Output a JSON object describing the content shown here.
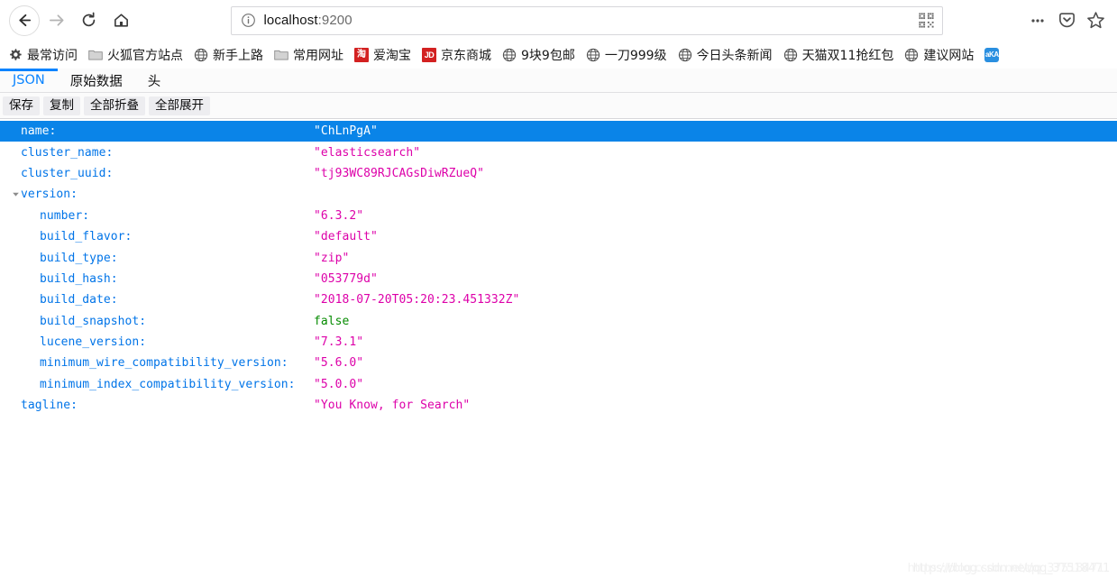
{
  "browser": {
    "nav": {
      "back_label": "Back",
      "forward_label": "Forward",
      "reload_label": "Reload",
      "home_label": "Home"
    },
    "address_bar": {
      "host": "localhost",
      "port": ":9200",
      "full_url": "localhost:9200",
      "info_icon": "info-icon",
      "qr_icon": "qr-code-icon"
    },
    "toolbar_icons": [
      {
        "name": "more-menu-icon",
        "glyph": "•••"
      },
      {
        "name": "pocket-icon"
      },
      {
        "name": "bookmark-star-icon"
      }
    ]
  },
  "bookmarks": {
    "items": [
      {
        "label": "最常访问",
        "icon": "gear-icon"
      },
      {
        "label": "火狐官方站点",
        "icon": "folder-icon"
      },
      {
        "label": "新手上路",
        "icon": "globe-icon"
      },
      {
        "label": "常用网址",
        "icon": "folder-icon"
      },
      {
        "label": "爱淘宝",
        "icon": "taobao-icon",
        "icon_text": "淘"
      },
      {
        "label": "京东商城",
        "icon": "jd-icon",
        "icon_text": "JD"
      },
      {
        "label": "9块9包邮",
        "icon": "globe-icon"
      },
      {
        "label": "一刀999级",
        "icon": "globe-icon"
      },
      {
        "label": "今日头条新闻",
        "icon": "globe-icon"
      },
      {
        "label": "天猫双11抢红包",
        "icon": "globe-icon"
      },
      {
        "label": "建议网站",
        "icon": "globe-icon"
      },
      {
        "label": "",
        "icon": "aka-icon",
        "icon_text": "aKA"
      }
    ]
  },
  "json_viewer": {
    "tabs": [
      {
        "label": "JSON",
        "active": true
      },
      {
        "label": "原始数据",
        "active": false
      },
      {
        "label": "头",
        "active": false
      }
    ],
    "actions": [
      {
        "label": "保存",
        "name": "save-button"
      },
      {
        "label": "复制",
        "name": "copy-button"
      },
      {
        "label": "全部折叠",
        "name": "collapse-all-button"
      },
      {
        "label": "全部展开",
        "name": "expand-all-button"
      }
    ],
    "rows": [
      {
        "key": "name:",
        "value": "\"ChLnPgA\"",
        "type": "string",
        "indent": 0,
        "selected": true,
        "twisty": ""
      },
      {
        "key": "cluster_name:",
        "value": "\"elasticsearch\"",
        "type": "string",
        "indent": 0,
        "selected": false,
        "twisty": ""
      },
      {
        "key": "cluster_uuid:",
        "value": "\"tj93WC89RJCAGsDiwRZueQ\"",
        "type": "string",
        "indent": 0,
        "selected": false,
        "twisty": ""
      },
      {
        "key": "version:",
        "value": "",
        "type": "object",
        "indent": 0,
        "selected": false,
        "twisty": "expanded"
      },
      {
        "key": "number:",
        "value": "\"6.3.2\"",
        "type": "string",
        "indent": 1,
        "selected": false,
        "twisty": ""
      },
      {
        "key": "build_flavor:",
        "value": "\"default\"",
        "type": "string",
        "indent": 1,
        "selected": false,
        "twisty": ""
      },
      {
        "key": "build_type:",
        "value": "\"zip\"",
        "type": "string",
        "indent": 1,
        "selected": false,
        "twisty": ""
      },
      {
        "key": "build_hash:",
        "value": "\"053779d\"",
        "type": "string",
        "indent": 1,
        "selected": false,
        "twisty": ""
      },
      {
        "key": "build_date:",
        "value": "\"2018-07-20T05:20:23.451332Z\"",
        "type": "string",
        "indent": 1,
        "selected": false,
        "twisty": ""
      },
      {
        "key": "build_snapshot:",
        "value": "false",
        "type": "boolean",
        "indent": 1,
        "selected": false,
        "twisty": ""
      },
      {
        "key": "lucene_version:",
        "value": "\"7.3.1\"",
        "type": "string",
        "indent": 1,
        "selected": false,
        "twisty": ""
      },
      {
        "key": "minimum_wire_compatibility_version:",
        "value": "\"5.6.0\"",
        "type": "string",
        "indent": 1,
        "selected": false,
        "twisty": ""
      },
      {
        "key": "minimum_index_compatibility_version:",
        "value": "\"5.0.0\"",
        "type": "string",
        "indent": 1,
        "selected": false,
        "twisty": ""
      },
      {
        "key": "tagline:",
        "value": "\"You Know, for Search\"",
        "type": "string",
        "indent": 0,
        "selected": false,
        "twisty": ""
      }
    ]
  },
  "watermark": {
    "line_a": "https://blog.csdn.net/qq_37518471",
    "line_b": "https://blog.csdn.net/qq_37518471"
  },
  "colors": {
    "accent_blue": "#0a84ff",
    "selected_row": "#0a84e8",
    "json_key": "#0074e8",
    "json_string": "#dd00a9",
    "json_boolean": "#058b00"
  }
}
